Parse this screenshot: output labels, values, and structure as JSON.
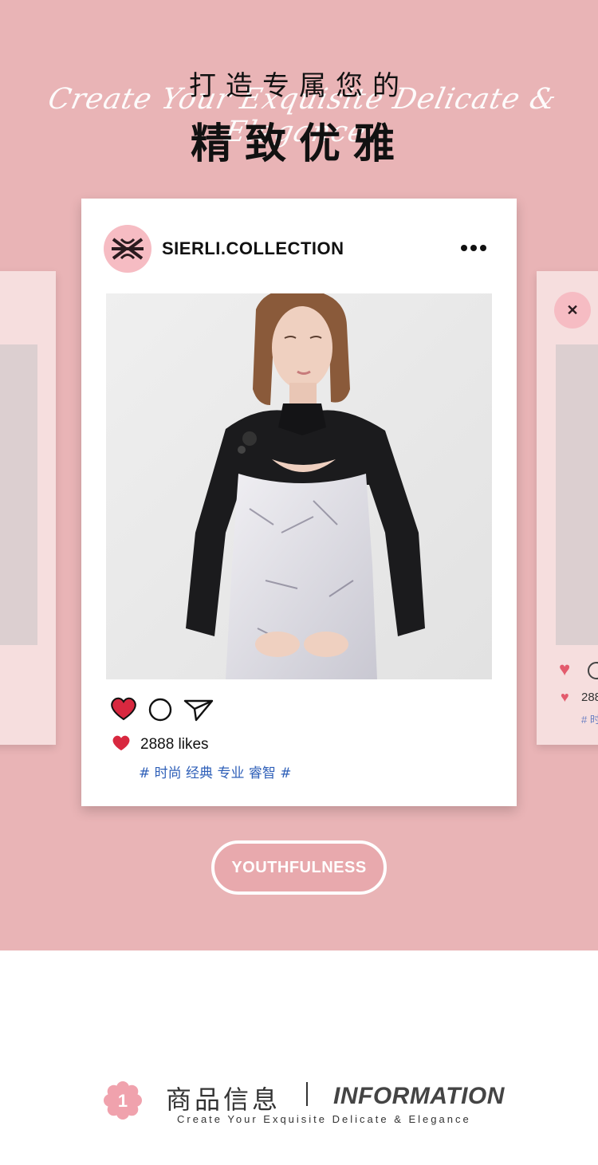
{
  "hero": {
    "title_line1": "打造专属您的",
    "script_text": "Create Your Exquisite Delicate & Elegance",
    "title_line2": "精致优雅"
  },
  "post": {
    "username": "SIERLI.COLLECTION",
    "likes_text": "2888 likes",
    "tags": "# 时尚 经典 专业 睿智 #",
    "avatar_icon": "sierli-logo-icon",
    "more_icon": "more-dots-icon",
    "like_icon": "heart-icon",
    "comment_icon": "comment-circle-icon",
    "share_icon": "send-icon"
  },
  "side_post": {
    "likes_text": "288",
    "tags": "# 时"
  },
  "cta": {
    "label": "YOUTHFULNESS"
  },
  "info": {
    "badge_number": "1",
    "title_cn": "商品信息",
    "title_en": "INFORMATION",
    "subtitle": "Create Your Exquisite Delicate & Elegance"
  },
  "colors": {
    "hero_bg": "#e9b4b6",
    "heart": "#d8283f",
    "tag_text": "#2e5fb8",
    "badge": "#f0a2ad"
  }
}
